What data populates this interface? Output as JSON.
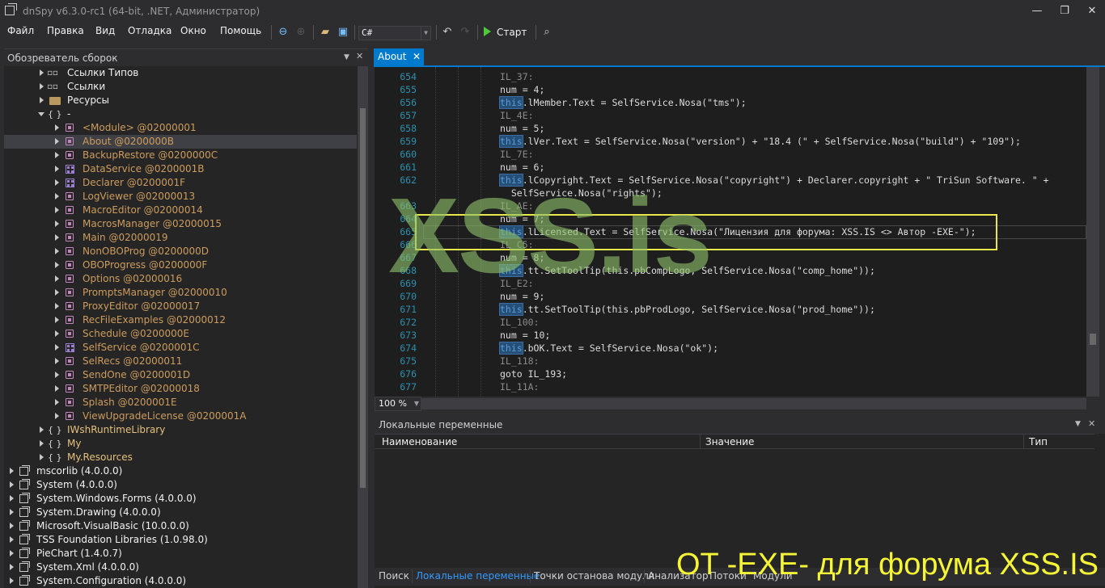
{
  "window": {
    "title": "dnSpy v6.3.0-rc1 (64-bit, .NET, Администратор)",
    "minimize": "—",
    "maximize": "❐",
    "close": "✕"
  },
  "menu": [
    "Файл",
    "Правка",
    "Вид",
    "Отладка",
    "Окно",
    "Помощь"
  ],
  "toolbar": {
    "language": "C#",
    "start_label": "Старт"
  },
  "explorer": {
    "title": "Обозреватель сборок",
    "items": [
      {
        "label": "Ссылки Типов",
        "icon": "type-refs-icon"
      },
      {
        "label": "Ссылки",
        "icon": "refs-icon"
      },
      {
        "label": "Ресурсы",
        "icon": "folder-icon"
      },
      {
        "label": "-",
        "icon": "namespace-icon"
      },
      {
        "label": "<Module> @02000001"
      },
      {
        "label": "About @0200000B"
      },
      {
        "label": "BackupRestore @0200000C"
      },
      {
        "label": "DataService @0200001B"
      },
      {
        "label": "Declarer @0200001F"
      },
      {
        "label": "LogViewer @02000013"
      },
      {
        "label": "MacroEditor @02000014"
      },
      {
        "label": "MacrosManager @02000015"
      },
      {
        "label": "Main @02000019"
      },
      {
        "label": "NonOBOProg @0200000D"
      },
      {
        "label": "OBOProgress @0200000F"
      },
      {
        "label": "Options @02000016"
      },
      {
        "label": "PromptsManager @02000010"
      },
      {
        "label": "ProxyEditor @02000017"
      },
      {
        "label": "RecFileExamples @02000012"
      },
      {
        "label": "Schedule @0200000E"
      },
      {
        "label": "SelfService @0200001C"
      },
      {
        "label": "SelRecs @02000011"
      },
      {
        "label": "SendOne @0200001D"
      },
      {
        "label": "SMTPEditor @02000018"
      },
      {
        "label": "Splash @0200001E"
      },
      {
        "label": "ViewUpgradeLicense @0200001A"
      },
      {
        "label": "IWshRuntimeLibrary"
      },
      {
        "label": "My"
      },
      {
        "label": "My.Resources"
      },
      {
        "label": "mscorlib (4.0.0.0)"
      },
      {
        "label": "System (4.0.0.0)"
      },
      {
        "label": "System.Windows.Forms (4.0.0.0)"
      },
      {
        "label": "System.Drawing (4.0.0.0)"
      },
      {
        "label": "Microsoft.VisualBasic (10.0.0.0)"
      },
      {
        "label": "TSS Foundation Libraries (1.0.98.0)"
      },
      {
        "label": "PieChart (1.4.0.7)"
      },
      {
        "label": "System.Xml (4.0.0.0)"
      },
      {
        "label": "System.Configuration (4.0.0.0)"
      }
    ]
  },
  "editor": {
    "tab_label": "About",
    "zoom": "100 %",
    "line_numbers": [
      "654",
      "655",
      "656",
      "657",
      "658",
      "659",
      "660",
      "661",
      "662",
      "",
      "663",
      "664",
      "665",
      "666",
      "667",
      "668",
      "669",
      "670",
      "671",
      "672",
      "673",
      "674",
      "675",
      "676",
      "677"
    ],
    "lines": [
      {
        "label": "IL_37:"
      },
      {
        "plain": "num = 4;"
      },
      {
        "kw": "this",
        "rest": ".lMember.Text = SelfService.Nosa(\"tms\");"
      },
      {
        "label": "IL_4E:"
      },
      {
        "plain": "num = 5;"
      },
      {
        "kw": "this",
        "rest": ".lVer.Text = SelfService.Nosa(\"version\") + \"18.4 (\" + SelfService.Nosa(\"build\") + \"109\");"
      },
      {
        "label": "IL_7E:"
      },
      {
        "plain": "num = 6;"
      },
      {
        "kw": "this",
        "rest": ".lCopyright.Text = SelfService.Nosa(\"copyright\") + Declarer.copyright + \" TriSun Software. \" +"
      },
      {
        "plain": "  SelfService.Nosa(\"rights\");"
      },
      {
        "label": "IL_AE:"
      },
      {
        "plain": "num = 7;"
      },
      {
        "kw": "this",
        "rest": ".lLicensed.Text = SelfService.Nosa(\"Лицензия для форума: XSS.IS <> Автор -EXE-\");"
      },
      {
        "label": "IL_C5:"
      },
      {
        "plain": "num = 8;"
      },
      {
        "kw": "this",
        "rest": ".tt.SetToolTip(this.pbCompLogo, SelfService.Nosa(\"comp_home\"));"
      },
      {
        "label": "IL_E2:"
      },
      {
        "plain": "num = 9;"
      },
      {
        "kw": "this",
        "rest": ".tt.SetToolTip(this.pbProdLogo, SelfService.Nosa(\"prod_home\"));"
      },
      {
        "label": "IL_100:"
      },
      {
        "plain": "num = 10;"
      },
      {
        "kw": "this",
        "rest": ".bOK.Text = SelfService.Nosa(\"ok\");"
      },
      {
        "label": "IL_118:"
      },
      {
        "plain": "goto IL_193;"
      },
      {
        "label": "IL_11A:"
      }
    ]
  },
  "locals": {
    "title": "Локальные переменные",
    "columns": [
      "Наименование",
      "Значение",
      "Тип"
    ]
  },
  "bottom_tabs": [
    "Поиск",
    "Локальные переменные",
    "Точки останова модуля",
    "Анализатор",
    "Потоки",
    "Модули"
  ],
  "watermarks": {
    "center": "XSS.is",
    "footer": "OT -EXE- для форума XSS.IS"
  },
  "colors": {
    "accent": "#007acc",
    "highlight_box": "#e8e84a",
    "watermark": "#8cbe69"
  }
}
